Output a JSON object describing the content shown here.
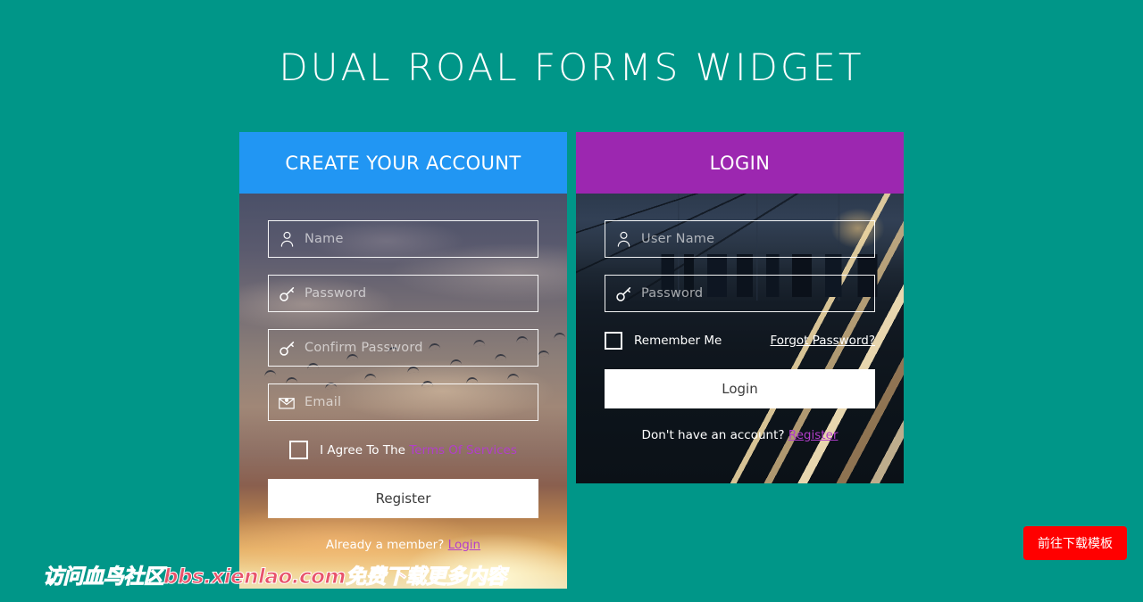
{
  "page": {
    "title": "DUAL ROAL FORMS WIDGET",
    "background_color": "#009688"
  },
  "register_panel": {
    "header": "CREATE YOUR ACCOUNT",
    "header_color": "#2196f3",
    "fields": [
      {
        "icon": "user-icon",
        "placeholder": "Name"
      },
      {
        "icon": "key-icon",
        "placeholder": "Password"
      },
      {
        "icon": "key-icon",
        "placeholder": "Confirm Password"
      },
      {
        "icon": "envelope-icon",
        "placeholder": "Email"
      }
    ],
    "terms_prefix": "I Agree To The",
    "terms_link": "Terms Of Services",
    "terms_link_color": "#b23ecb",
    "submit_label": "Register",
    "footnote_prefix": "Already a member?",
    "footnote_link": "Login"
  },
  "login_panel": {
    "header": "LOGIN",
    "header_color": "#9c27b0",
    "fields": [
      {
        "icon": "user-icon",
        "placeholder": "User Name"
      },
      {
        "icon": "key-icon",
        "placeholder": "Password"
      }
    ],
    "remember_label": "Remember Me",
    "forgot_link": "Forgot Password?",
    "submit_label": "Login",
    "footnote_prefix": "Don't have an account?",
    "footnote_link": "Register"
  },
  "overlay": {
    "watermark": "访问血鸟社区bbs.xienlao.com免费下载更多内容",
    "download_button": "前往下载模板",
    "download_button_color": "#ff0000"
  }
}
